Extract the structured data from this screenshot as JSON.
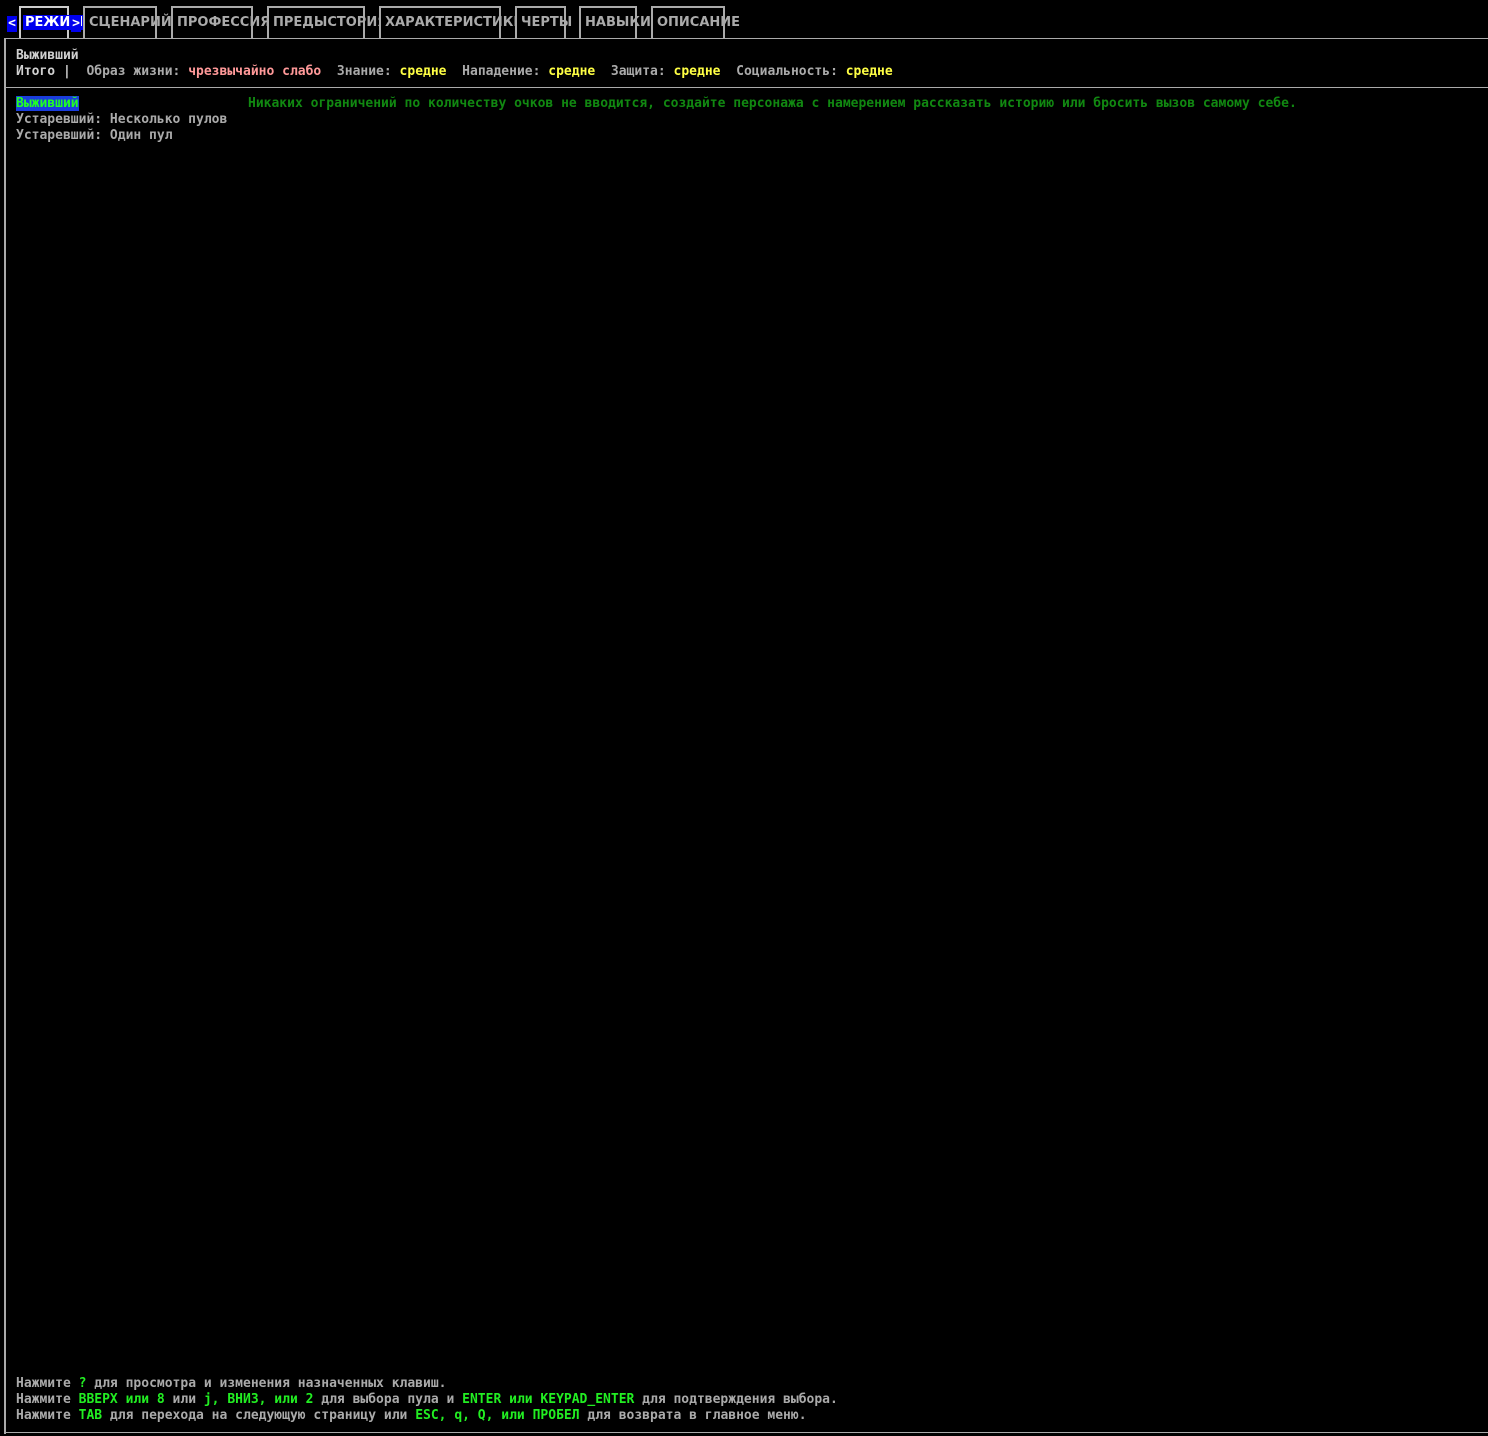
{
  "tabs": {
    "prev_arrow": "<",
    "next_arrow": ">",
    "items": [
      {
        "label": "РЕЖИМ"
      },
      {
        "label": "СЦЕНАРИЙ"
      },
      {
        "label": "ПРОФЕССИЯ"
      },
      {
        "label": "ПРЕДЫСТОРИЯ"
      },
      {
        "label": "ХАРАКТЕРИСТИКИ"
      },
      {
        "label": "ЧЕРТЫ"
      },
      {
        "label": "НАВЫКИ"
      },
      {
        "label": "ОПИСАНИЕ"
      }
    ]
  },
  "summary": {
    "mode_name": "Выживший",
    "total_label": "Итого |",
    "lifestyle_label": "Образ жизни:",
    "lifestyle_value": "чрезвычайно слабо",
    "knowledge_label": "Знание:",
    "knowledge_value": "средне",
    "attack_label": "Нападение:",
    "attack_value": "средне",
    "defense_label": "Защита:",
    "defense_value": "средне",
    "social_label": "Социальность:",
    "social_value": "средне"
  },
  "pools": {
    "items": [
      {
        "label": "Выживший"
      },
      {
        "label": "Устаревший: Несколько пулов"
      },
      {
        "label": "Устаревший: Один пул"
      }
    ],
    "description": "Никаких ограничений по количеству очков не вводится, создайте персонажа с намерением рассказать историю или бросить вызов самому себе."
  },
  "help": {
    "line1": {
      "a": "Нажмите ",
      "b": "?",
      "c": " для просмотра и изменения назначенных клавиш."
    },
    "line2": {
      "a": "Нажмите ",
      "b": "ВВЕРХ или 8",
      "c": " или ",
      "d": "j, ВНИЗ, или 2",
      "e": " для выбора пула и ",
      "f": "ENTER или KEYPAD_ENTER",
      "g": " для подтверждения выбора."
    },
    "line3": {
      "a": "Нажмите ",
      "b": "TAB",
      "c": " для перехода на следующую страницу или ",
      "d": "ESC, q, Q, или ПРОБЕЛ",
      "e": " для возврата в главное меню."
    }
  },
  "colors": {
    "background": "#000000",
    "text": "#aaaaaa",
    "highlight_blue": "#0000ee",
    "value_yellow": "#ffff44",
    "value_red": "#ff9999",
    "key_green": "#22ee22",
    "description_green": "#118811"
  }
}
